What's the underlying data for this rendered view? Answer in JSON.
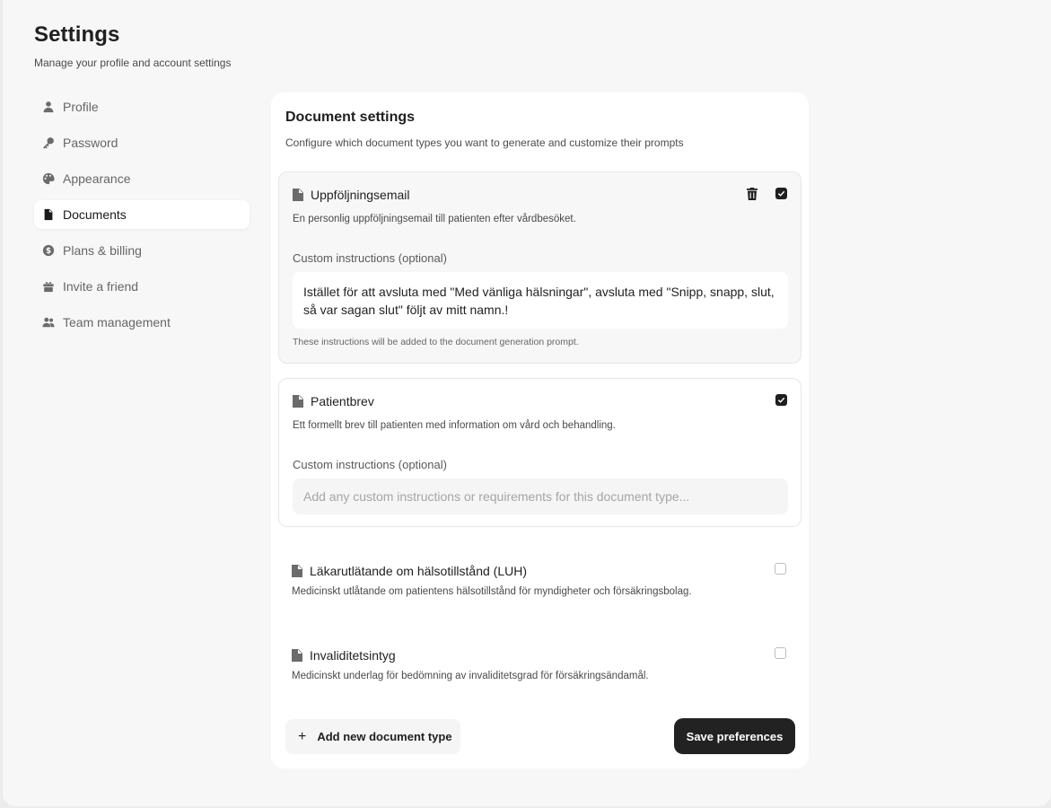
{
  "page": {
    "title": "Settings",
    "subtitle": "Manage your profile and account settings"
  },
  "sidebar": {
    "items": [
      {
        "label": "Profile",
        "icon": "user-icon",
        "active": false
      },
      {
        "label": "Password",
        "icon": "key-icon",
        "active": false
      },
      {
        "label": "Appearance",
        "icon": "palette-icon",
        "active": false
      },
      {
        "label": "Documents",
        "icon": "document-icon",
        "active": true
      },
      {
        "label": "Plans & billing",
        "icon": "dollar-icon",
        "active": false
      },
      {
        "label": "Invite a friend",
        "icon": "gift-icon",
        "active": false
      },
      {
        "label": "Team management",
        "icon": "users-icon",
        "active": false
      }
    ]
  },
  "documents": {
    "title": "Document settings",
    "description": "Configure which document types you want to generate and customize their prompts",
    "custom_label": "Custom instructions (optional)",
    "hint": "These instructions will be added to the document generation prompt.",
    "items": [
      {
        "name": "Uppföljningsemail",
        "description": "En personlig uppföljningsemail till patienten efter vårdbesöket.",
        "enabled": true,
        "deletable": true,
        "instructions": "Istället för att avsluta med \"Med vänliga hälsningar\", avsluta med \"Snipp, snapp, slut, så var sagan slut\" följt av mitt namn.!"
      },
      {
        "name": "Patientbrev",
        "description": "Ett formellt brev till patienten med information om vård och behandling.",
        "enabled": true,
        "placeholder": "Add any custom instructions or requirements for this document type..."
      },
      {
        "name": "Läkarutlätande om hälsotillstånd (LUH)",
        "description": "Medicinskt utlåtande om patientens hälsotillstånd för myndigheter och försäkringsbolag.",
        "enabled": false
      },
      {
        "name": "Invaliditetsintyg",
        "description": "Medicinskt underlag för bedömning av invaliditetsgrad för försäkringsändamål.",
        "enabled": false
      }
    ],
    "add_label": "Add new document type",
    "save_label": "Save preferences"
  },
  "colors": {
    "background": "#f7f7f7",
    "panel": "#ffffff",
    "accent": "#222222"
  }
}
